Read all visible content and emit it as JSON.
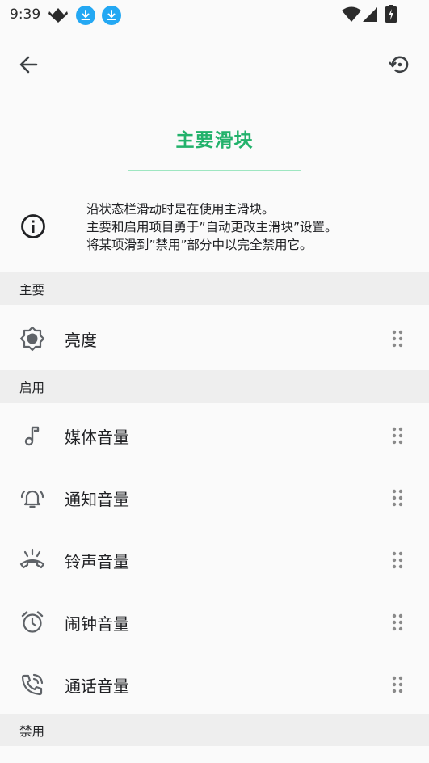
{
  "status_bar": {
    "time": "9:39",
    "icons": [
      "app-logo-icon",
      "download-icon",
      "download-icon",
      "wifi-icon",
      "cell-signal-icon",
      "battery-charging-icon"
    ]
  },
  "toolbar": {
    "back_icon": "arrow-back-icon",
    "reset_icon": "restore-icon"
  },
  "title": "主要滑块",
  "info": {
    "icon": "info-icon",
    "lines": [
      "沿状态栏滑动时是在使用主滑块。",
      "主要和启用项目勇于”自动更改主滑块”设置。",
      "将某项滑到”禁用”部分中以完全禁用它。"
    ]
  },
  "sections": {
    "main": {
      "header": "主要",
      "items": [
        {
          "label": "亮度",
          "icon": "brightness-icon"
        }
      ]
    },
    "enabled": {
      "header": "启用",
      "items": [
        {
          "label": "媒体音量",
          "icon": "music-note-icon"
        },
        {
          "label": "通知音量",
          "icon": "notification-bell-icon"
        },
        {
          "label": "铃声音量",
          "icon": "ringer-icon"
        },
        {
          "label": "闹钟音量",
          "icon": "alarm-icon"
        },
        {
          "label": "通话音量",
          "icon": "phone-call-icon"
        }
      ]
    },
    "disabled": {
      "header": "禁用"
    }
  },
  "colors": {
    "accent": "#22b26b",
    "accent_line": "#9ee6c1",
    "section_bg": "#eeeeee",
    "background": "#fafafa",
    "icon": "#5f6368",
    "download_badge": "#24a8f3"
  }
}
